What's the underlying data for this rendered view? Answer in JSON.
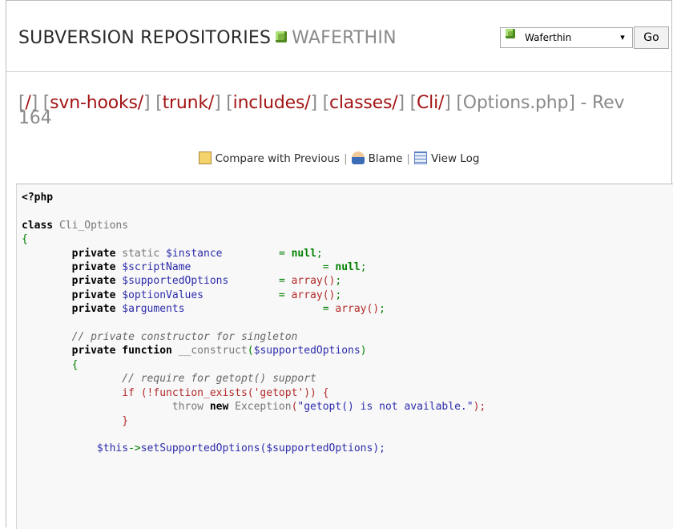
{
  "header": {
    "title_main": "SUBVERSION REPOSITORIES",
    "title_repo": "WAFERTHIN",
    "repo_select_value": "Waferthin",
    "go_label": "Go",
    "cube_icon_color": "#7cb342"
  },
  "breadcrumb": {
    "items": [
      "/",
      "svn-hooks/",
      "trunk/",
      "includes/",
      "classes/",
      "Cli/"
    ],
    "current": "Options.php",
    "revision": "- Rev 164"
  },
  "actions": {
    "compare_label": "Compare with Previous",
    "blame_label": "Blame",
    "log_label": "View Log",
    "separator": "|"
  },
  "code": {
    "line1": "<?php",
    "class_kw": "class",
    "class_name": "Cli_Options",
    "open_brace": "{",
    "private": "private",
    "static": "static",
    "function": "function",
    "instance": "$instance",
    "scriptName": "$scriptName",
    "supportedOptions": "$supportedOptions",
    "optionValues": "$optionValues",
    "arguments": "$arguments",
    "null": "null",
    "array": "array()",
    "comment1": "// private constructor for singleton",
    "construct": "__construct",
    "comment2": "// require for getopt() support",
    "if_kw": "if",
    "function_exists": "function_exists",
    "getopt_str": "'getopt'",
    "throw": "throw",
    "new": "new",
    "exception": "Exception",
    "exception_msg": "\"getopt() is not available.\"",
    "this": "$this",
    "setSupported": "setSupportedOptions"
  }
}
